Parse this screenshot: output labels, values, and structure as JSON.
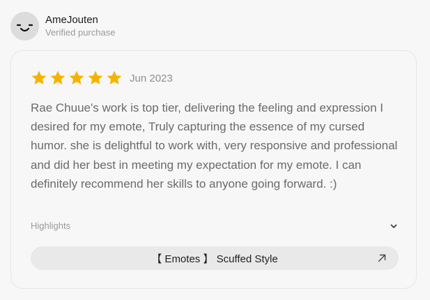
{
  "reviewer": {
    "name": "AmeJouten",
    "badge": "Verified purchase",
    "avatar_icon": "smiley-face-icon"
  },
  "review": {
    "rating": 5,
    "rating_max": 5,
    "star_color": "#f5b301",
    "date": "Jun 2023",
    "text": "Rae Chuue's work is top tier, delivering the feeling and expression I desired for my emote, Truly capturing the essence of my cursed humor. she is delightful to work with, very responsive and professional and did her best in meeting my expectation for my emote. I can definitely recommend her skills to anyone going forward. :)"
  },
  "highlights": {
    "label": "Highlights",
    "icon": "chevron-down-icon"
  },
  "product": {
    "name": "【 Emotes 】 Scuffed Style",
    "icon": "arrow-up-right-icon"
  }
}
